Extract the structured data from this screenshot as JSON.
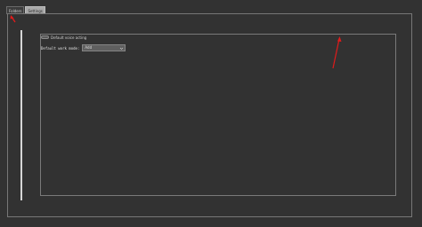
{
  "tabs": [
    {
      "label": "Folders",
      "active": false
    },
    {
      "label": "Settings",
      "active": true
    }
  ],
  "settings": {
    "voice_checkbox": {
      "label": "Default voice acting",
      "checked": false
    },
    "work_mode": {
      "label": "Default work mode:",
      "value": "Add"
    }
  },
  "colors": {
    "background": "#323232",
    "border": "#777777",
    "active_tab": "#a9a9a9",
    "annotation_arrow": "#e01b1b"
  }
}
